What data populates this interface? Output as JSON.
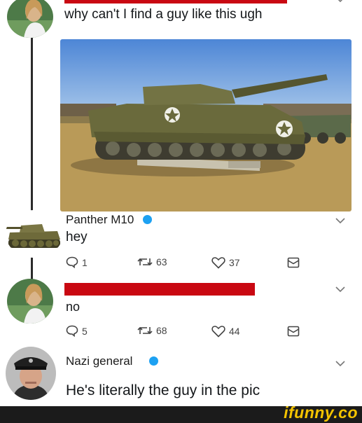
{
  "tweet1": {
    "text": "why can't I find a guy like this ugh"
  },
  "tweet2": {
    "name": "Panther M10",
    "text": "hey",
    "replies": "1",
    "retweets": "63",
    "likes": "37"
  },
  "tweet3": {
    "text": "no",
    "replies": "5",
    "retweets": "68",
    "likes": "44"
  },
  "tweet4": {
    "name": "Nazi general",
    "text": "He's literally the guy in the pic"
  },
  "watermark": "ifunny.co",
  "colors": {
    "verified": "#1da1f2",
    "redacted": "#c90812",
    "footer": "#1b1b1b",
    "brand": "#f5c400"
  }
}
